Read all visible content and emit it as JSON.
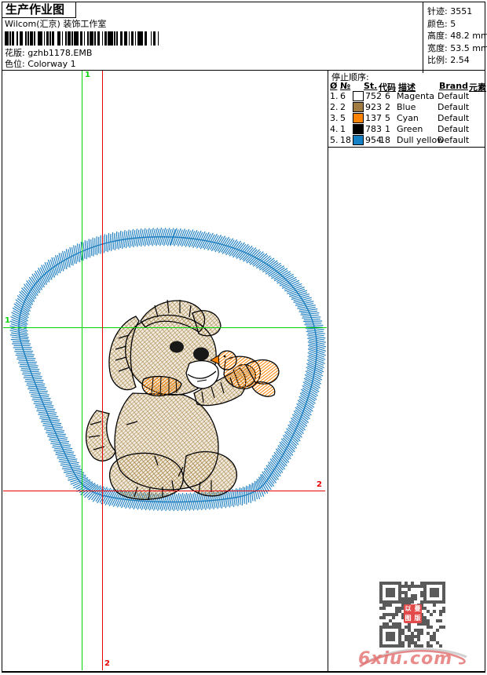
{
  "header": {
    "title": "生产作业图",
    "studio": "Wilcom(汇京) 装饰工作室",
    "pattern_label": "花版:",
    "pattern_value": "gzhb1178.EMB",
    "colorway_label": "色位:",
    "colorway_value": "Colorway 1"
  },
  "info": {
    "rows": [
      {
        "label": "针迹:",
        "value": "3551"
      },
      {
        "label": "颜色:",
        "value": "5"
      },
      {
        "label": "高度:",
        "value": "48.2 mm"
      },
      {
        "label": "宽度:",
        "value": "53.5 mm"
      },
      {
        "label": "比例:",
        "value": "2.54"
      }
    ]
  },
  "stop_sequence": {
    "title": "停止顺序:",
    "columns": [
      "Ø",
      "№",
      "St.",
      "代码",
      "描述",
      "Brand",
      "元素"
    ],
    "rows": [
      {
        "index": "1.",
        "no": "6",
        "swatch": "#ffffff",
        "st": "752",
        "code": "6",
        "desc": "Magenta",
        "brand": "Default",
        "element": ""
      },
      {
        "index": "2.",
        "no": "2",
        "swatch": "#a07c42",
        "st": "923",
        "code": "2",
        "desc": "Blue",
        "brand": "Default",
        "element": ""
      },
      {
        "index": "3.",
        "no": "5",
        "swatch": "#ff8300",
        "st": "137",
        "code": "5",
        "desc": "Cyan",
        "brand": "Default",
        "element": ""
      },
      {
        "index": "4.",
        "no": "1",
        "swatch": "#000000",
        "st": "783",
        "code": "1",
        "desc": "Green",
        "brand": "Default",
        "element": ""
      },
      {
        "index": "5.",
        "no": "18",
        "swatch": "#1680c4",
        "st": "954",
        "code": "18",
        "desc": "Dull yellow",
        "brand": "Default",
        "element": ""
      }
    ]
  },
  "guides": {
    "start_label": "1",
    "end_label": "2",
    "green": "#00d400",
    "red": "#e60000"
  },
  "design": {
    "ring_color": "#1e7fc0",
    "body_color": "#a5813e",
    "accent_color": "#ff8300",
    "outline_color": "#000000"
  },
  "barcode": {
    "bars": [
      3,
      1,
      1,
      1,
      2,
      2,
      1,
      1,
      3,
      2,
      1,
      1,
      1,
      1,
      2,
      1,
      1,
      2,
      4,
      1,
      1,
      1,
      2,
      1,
      1,
      1,
      2,
      2,
      3,
      1,
      1,
      2,
      1,
      1,
      2,
      1,
      1,
      1,
      4,
      1,
      2,
      1,
      1,
      2,
      1,
      1,
      3,
      1,
      1,
      1,
      2,
      2,
      1,
      1,
      2,
      1,
      4,
      1,
      1,
      1,
      1,
      2,
      2,
      1,
      3,
      1,
      1,
      1,
      2,
      1,
      1,
      1,
      5,
      1,
      2,
      3,
      1,
      1,
      2,
      2,
      1,
      4
    ]
  },
  "watermark": {
    "text": "6xiu.com",
    "seal_chars": [
      "以",
      "曼",
      "图",
      "版"
    ]
  }
}
